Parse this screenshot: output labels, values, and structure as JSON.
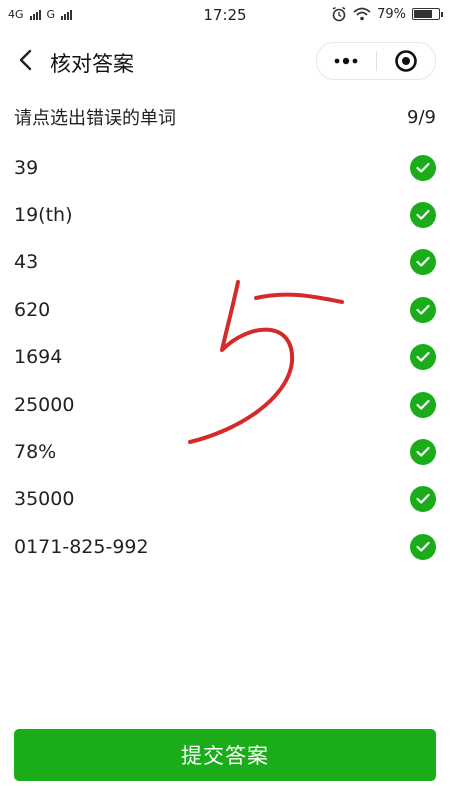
{
  "status_bar": {
    "network_left": "4G",
    "network_right": "G",
    "time": "17:25",
    "battery_percent": "79%",
    "battery_level": 0.79
  },
  "nav": {
    "title": "核对答案",
    "back_icon": "chevron-left-icon",
    "more_icon": "more-dots-icon",
    "close_icon": "target-circle-icon"
  },
  "header": {
    "instruction": "请点选出错误的单词",
    "progress": "9/9"
  },
  "answers": [
    {
      "text": "39",
      "status": "correct"
    },
    {
      "text": "19(th)",
      "status": "correct"
    },
    {
      "text": "43",
      "status": "correct"
    },
    {
      "text": "620",
      "status": "correct"
    },
    {
      "text": "1694",
      "status": "correct"
    },
    {
      "text": "25000",
      "status": "correct"
    },
    {
      "text": "78%",
      "status": "correct"
    },
    {
      "text": "35000",
      "status": "correct"
    },
    {
      "text": "0171-825-992",
      "status": "correct"
    }
  ],
  "submit_label": "提交答案",
  "colors": {
    "accent_green": "#1aad19",
    "handwriting_red": "#d42a2a"
  }
}
